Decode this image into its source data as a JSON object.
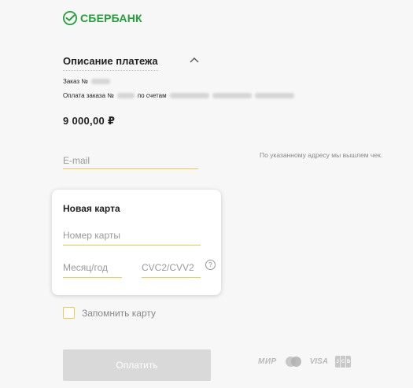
{
  "logo": {
    "text": "СБЕРБАНК",
    "icon": "sberbank-logo-icon",
    "color": "#21a038"
  },
  "description": {
    "title": "Описание платежа",
    "order_label": "Заказ №",
    "payment_prefix": "Оплата заказа №",
    "payment_middle": "по счетам",
    "amount": "9 000,00 ₽"
  },
  "email": {
    "placeholder": "E-mail",
    "hint": "По указанному адресу мы вышлем чек."
  },
  "card": {
    "title": "Новая карта",
    "number_placeholder": "Номер карты",
    "expiry_placeholder": "Месяц/год",
    "cvc_placeholder": "CVC2/CVV2",
    "help_mark": "?"
  },
  "remember": {
    "label": "Запомнить карту"
  },
  "pay_button": {
    "label": "Оплатить"
  },
  "payment_systems": {
    "mir": "МИР",
    "visa": "VISA",
    "jcb": [
      "J",
      "C",
      "B"
    ]
  },
  "colors": {
    "accent": "#f2c84b",
    "brand": "#21a038",
    "button_disabled": "#d9d9d9"
  }
}
